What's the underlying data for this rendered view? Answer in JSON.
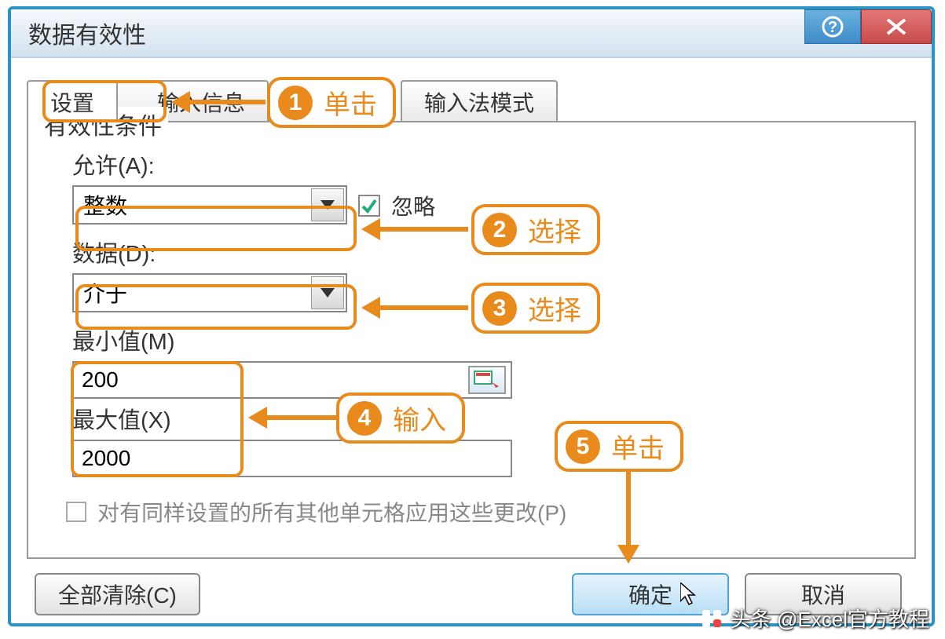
{
  "dialog": {
    "title": "数据有效性"
  },
  "tabs": {
    "t1": "设置",
    "t2": "输入信息",
    "t3": "输入法模式"
  },
  "panel": {
    "group": "有效性条件",
    "allow_label": "允许(A):",
    "allow_value": "整数",
    "ignore_label": "忽略",
    "data_label": "数据(D):",
    "data_value": "介于",
    "min_label": "最小值(M)",
    "min_value": "200",
    "max_label": "最大值(X)",
    "max_value": "2000",
    "apply_all": "对有同样设置的所有其他单元格应用这些更改(P)"
  },
  "buttons": {
    "clear": "全部清除(C)",
    "ok": "确定",
    "cancel": "取消"
  },
  "callouts": {
    "c1": "单击",
    "c2": "选择",
    "c3": "选择",
    "c4": "输入",
    "c5": "单击"
  },
  "watermark": "头条 @Excel官方教程"
}
